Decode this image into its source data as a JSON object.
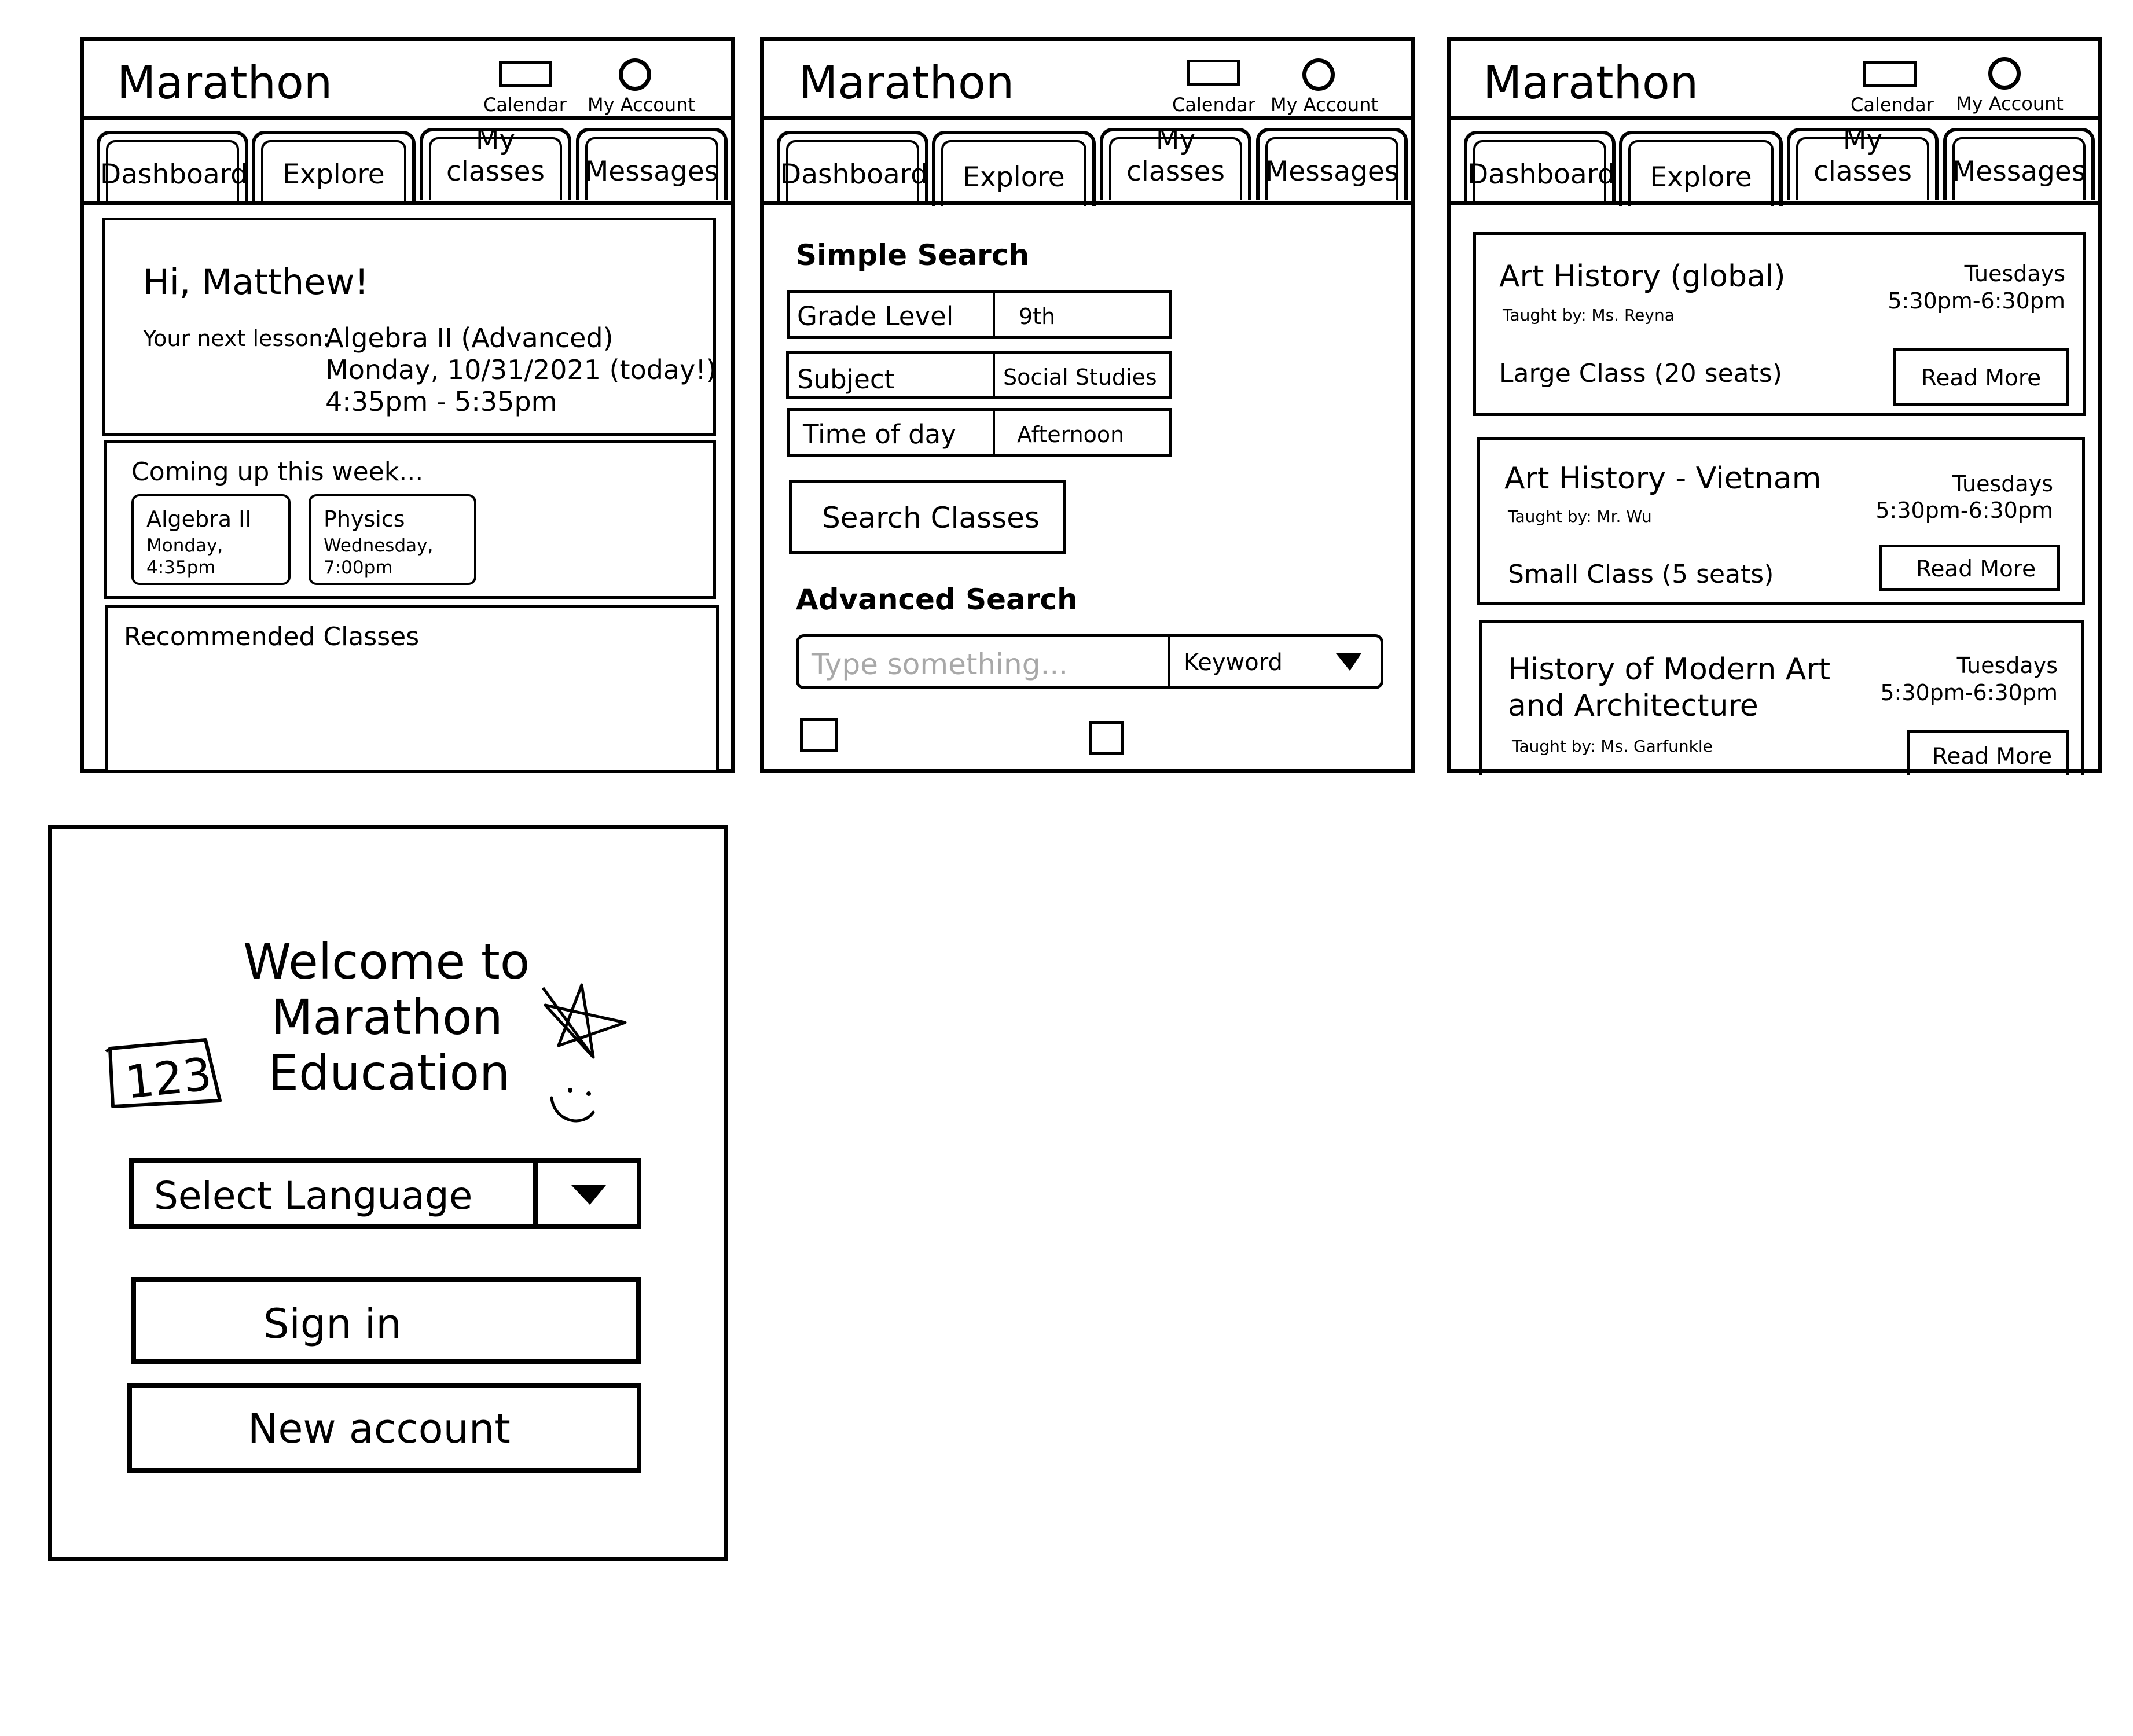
{
  "brand": "Marathon",
  "header": {
    "calendar_label": "Calendar",
    "account_label": "My Account"
  },
  "tabs": [
    "Dashboard",
    "Explore",
    "My classes",
    "Messages"
  ],
  "dashboard": {
    "greeting": "Hi, Matthew!",
    "next_lesson_label": "Your next lesson:",
    "next_lesson_class": "Algebra II (Advanced)",
    "next_lesson_date": "Monday, 10/31/2021 (today!)",
    "next_lesson_time": "4:35pm - 5:35pm",
    "coming_up_title": "Coming up this week...",
    "upcoming": [
      {
        "title": "Algebra II",
        "day": "Monday,",
        "time": "4:35pm"
      },
      {
        "title": "Physics",
        "day": "Wednesday,",
        "time": "7:00pm"
      }
    ],
    "recommended_title": "Recommended Classes"
  },
  "explore": {
    "simple_search_title": "Simple Search",
    "filters": [
      {
        "label": "Grade Level",
        "value": "9th"
      },
      {
        "label": "Subject",
        "value": "Social Studies"
      },
      {
        "label": "Time of day",
        "value": "Afternoon"
      }
    ],
    "search_button": "Search Classes",
    "advanced_search_title": "Advanced Search",
    "search_placeholder": "Type something...",
    "search_type": "Keyword"
  },
  "results": [
    {
      "title": "Art History (global)",
      "teacher": "Taught by: Ms. Reyna",
      "day": "Tuesdays",
      "time": "5:30pm-6:30pm",
      "size": "Large Class (20 seats)",
      "button": "Read More"
    },
    {
      "title": "Art History - Vietnam",
      "teacher": "Taught by: Mr. Wu",
      "day": "Tuesdays",
      "time": "5:30pm-6:30pm",
      "size": "Small Class (5 seats)",
      "button": "Read More"
    },
    {
      "title_line1": "History of Modern Art",
      "title_line2": "and Architecture",
      "teacher": "Taught by: Ms. Garfunkle",
      "day": "Tuesdays",
      "time": "5:30pm-6:30pm",
      "button": "Read More"
    }
  ],
  "welcome": {
    "title_line1": "Welcome to",
    "title_line2": "Marathon",
    "title_line3": "Education",
    "doodle_text": "123",
    "language_select": "Select Language",
    "sign_in": "Sign in",
    "new_account": "New account"
  }
}
